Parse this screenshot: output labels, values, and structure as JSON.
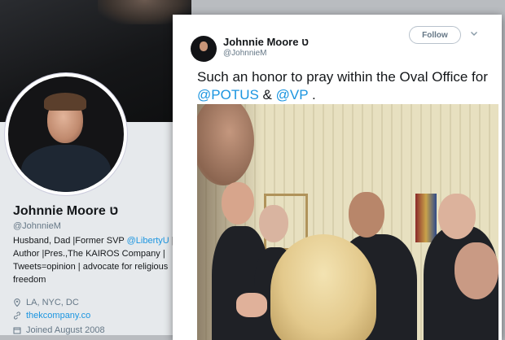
{
  "profile": {
    "name": "Johnnie Moore ט",
    "handle": "@JohnnieM",
    "bio_part1": "Husband, Dad |Former SVP ",
    "bio_link": "@LibertyU",
    "bio_part2": " | Author |Pres.,The KAIROS Company | Tweets=opinion | advocate for religious freedom",
    "location": "LA, NYC, DC",
    "website": "thekcompany.co",
    "joined": "Joined August 2008"
  },
  "tweet": {
    "name": "Johnnie Moore ט",
    "handle": "@JohnnieM",
    "follow_label": "Follow",
    "text_part1": "Such an honor to pray within the Oval Office for ",
    "mention_1": "@POTUS",
    "text_part2": " & ",
    "mention_2": "@VP",
    "text_part3": " ."
  },
  "colors": {
    "link": "#1b95e0",
    "secondary_text": "#657786",
    "primary_text": "#14171a"
  }
}
